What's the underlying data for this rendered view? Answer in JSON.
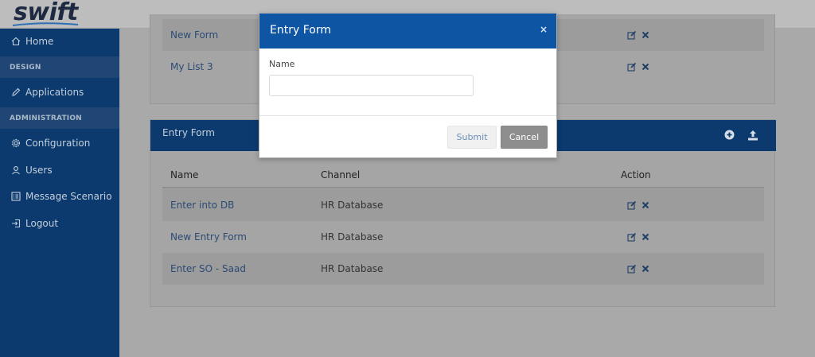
{
  "app": {
    "logo": "swift"
  },
  "sidebar": {
    "home": {
      "label": "Home",
      "icon": "home-icon"
    },
    "section_design": "DESIGN",
    "applications": {
      "label": "Applications",
      "icon": "pencil-icon"
    },
    "section_admin": "ADMINISTRATION",
    "configuration": {
      "label": "Configuration",
      "icon": "gear-icon"
    },
    "users": {
      "label": "Users",
      "icon": "user-icon"
    },
    "message_scenario": {
      "label": "Message Scenario",
      "icon": "grid-icon"
    },
    "logout": {
      "label": "Logout",
      "icon": "logout-icon"
    }
  },
  "top_list": {
    "rows": [
      {
        "name": "New Form"
      },
      {
        "name": "My List 3"
      }
    ]
  },
  "entry_form_panel": {
    "title": "Entry Form",
    "columns": {
      "name": "Name",
      "channel": "Channel",
      "action": "Action"
    },
    "rows": [
      {
        "name": "Enter into DB",
        "channel": "HR Database"
      },
      {
        "name": "New Entry Form",
        "channel": "HR Database"
      },
      {
        "name": "Enter SO - Saad",
        "channel": "HR Database"
      }
    ]
  },
  "modal": {
    "title": "Entry Form",
    "close": "×",
    "name_label": "Name",
    "name_value": "",
    "submit_label": "Submit",
    "cancel_label": "Cancel"
  },
  "colors": {
    "sidebar_bg": "#0c3a6e",
    "modal_header": "#0e56a4",
    "link": "#2c4b74",
    "cancel_bg": "#8e8e8e"
  }
}
